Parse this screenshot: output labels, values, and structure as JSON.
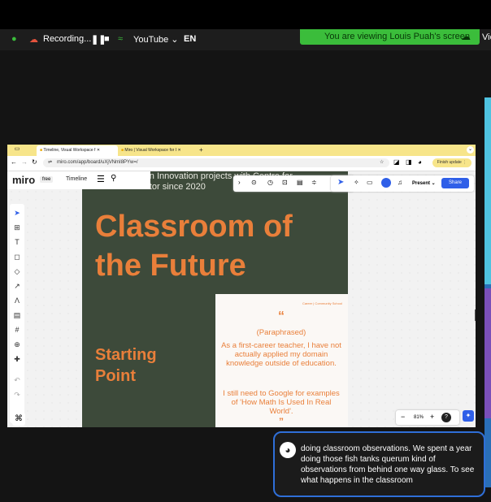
{
  "recording_bar": {
    "recording_label": "Recording...",
    "youtube_label": "YouTube",
    "language": "EN",
    "viewing_banner": "You are viewing Louis Puah's screen",
    "view_label": "Vie"
  },
  "browser": {
    "tabs": [
      {
        "label": "Timeline, Visual Workspace f",
        "active": true
      },
      {
        "label": "Miro | Visual Workspace for I",
        "active": false
      }
    ],
    "new_tab": "+",
    "url": "miro.com/app/board/uXjVNmI8PYw=/",
    "finish_update": "Finish update"
  },
  "miro": {
    "logo": "miro",
    "plan_badge": "free",
    "board_name": "Timeline",
    "present_label": "Present",
    "share_label": "Share",
    "zoom_level": "81%",
    "help_label": "?"
  },
  "slide": {
    "subtitle": "Education Innovation projects with Centre for Accelerator since 2020",
    "title": "Classroom of the Future",
    "starting_point": "Starting Point",
    "card_header": "Career | Community School",
    "quote_mark_open": "“",
    "paraphrased": "(Paraphrased)",
    "quote_1": "As a first-career teacher, I have not actually applied my domain knowledge outside of education.",
    "quote_2": "I still need to Google for examples of 'How Math Is Used In Real World'.",
    "quote_mark_close": "”"
  },
  "caption": {
    "text": "doing classroom observations. We spent a year doing those fish tanks querum kind of observations from behind one way glass. To see what happens in the classroom"
  },
  "colors": {
    "accent_orange": "#e97f3a",
    "slide_bg": "#3d4a3a",
    "banner_green": "#3bbd3b",
    "caption_border": "#2f6fd8"
  }
}
